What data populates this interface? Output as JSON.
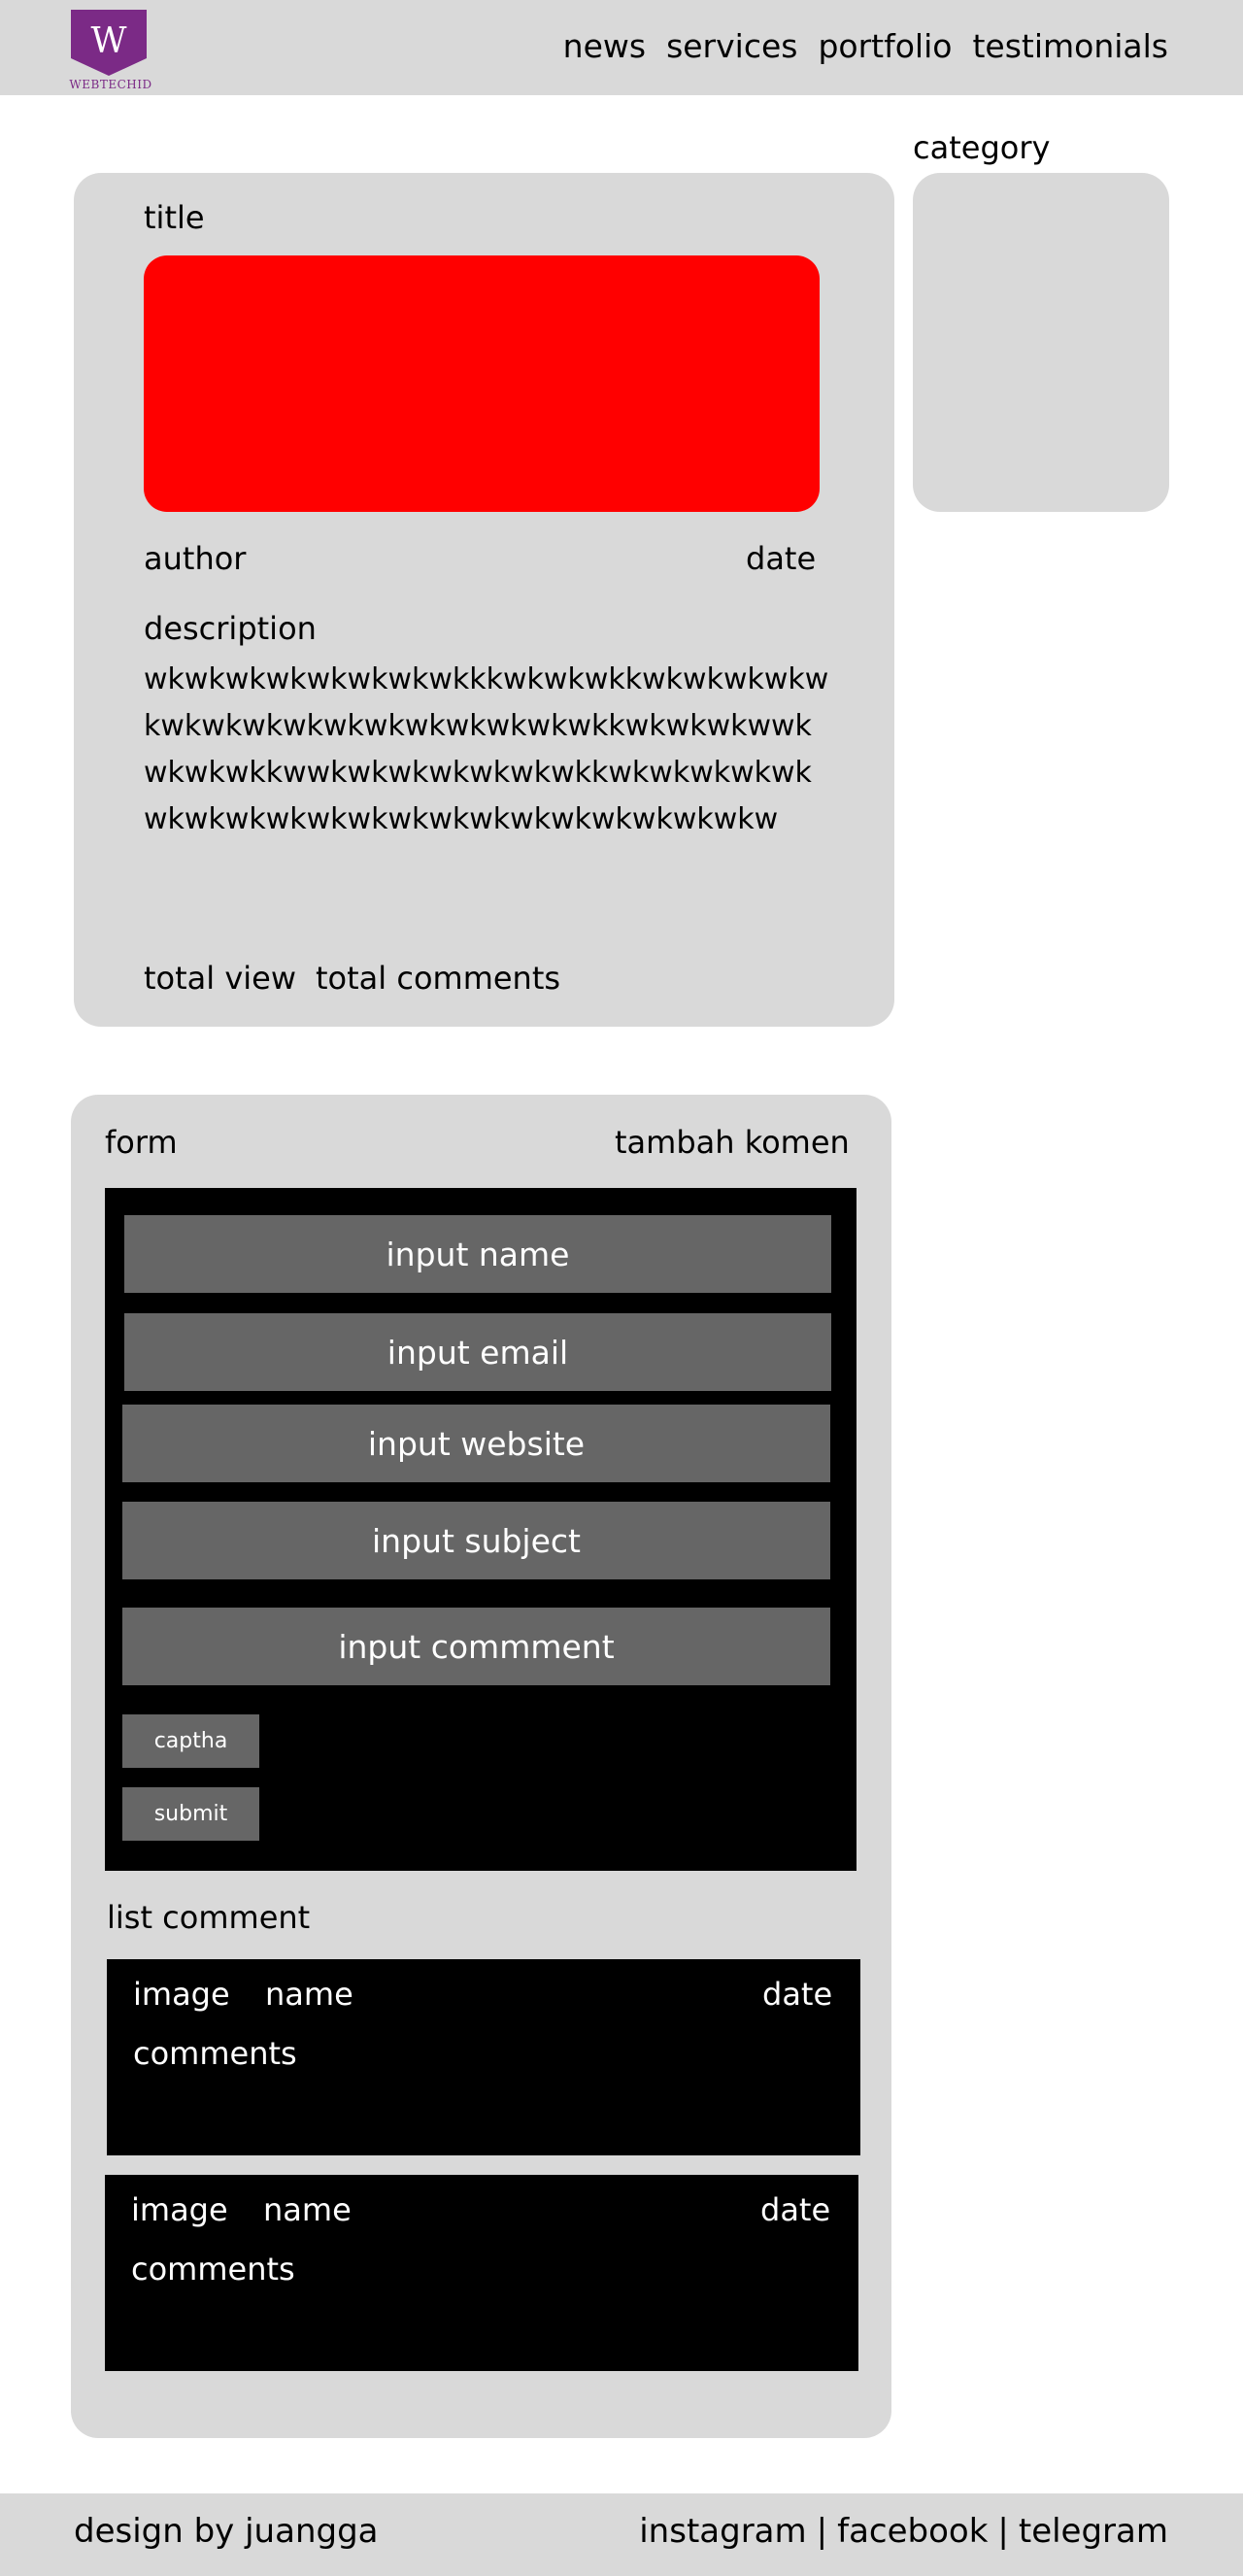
{
  "brand": {
    "logo_letter": "W",
    "name": "WEBTECHID",
    "color": "#7b2a86"
  },
  "nav": [
    "news",
    "services",
    "portfolio",
    "testimonials"
  ],
  "article": {
    "title": "title",
    "hero_color": "#ff0000",
    "author": "author",
    "date": "date",
    "description_label": "description",
    "description": "wkwkwkwkwkwkwkwkkkwkwkwkkwkwkwkwkwkwkwkwkwkwkwkwkwkwkwkwkkwkwkwkwwkwkwkwkkwwkwkwkwkwkwkwkkwkwkwkwkwkwkwkwkwkwkwkwkwkwkwkwkwkwkwkwkw",
    "total_view": "total view",
    "total_comments": "total comments"
  },
  "sidebar": {
    "category_label": "category"
  },
  "form": {
    "title": "form",
    "add_comment": "tambah komen",
    "inputs": {
      "name": "input name",
      "email": "input email",
      "website": "input website",
      "subject": "input subject",
      "comment": "input commment"
    },
    "captcha": "captha",
    "submit": "submit"
  },
  "comments": {
    "title": "list comment",
    "items": [
      {
        "image": "image",
        "name": "name",
        "date": "date",
        "text": "comments"
      },
      {
        "image": "image",
        "name": "name",
        "date": "date",
        "text": "comments"
      }
    ]
  },
  "footer": {
    "credit": "design by juangga",
    "links": [
      "instagram",
      "facebook",
      "telegram"
    ],
    "separator": "|"
  }
}
